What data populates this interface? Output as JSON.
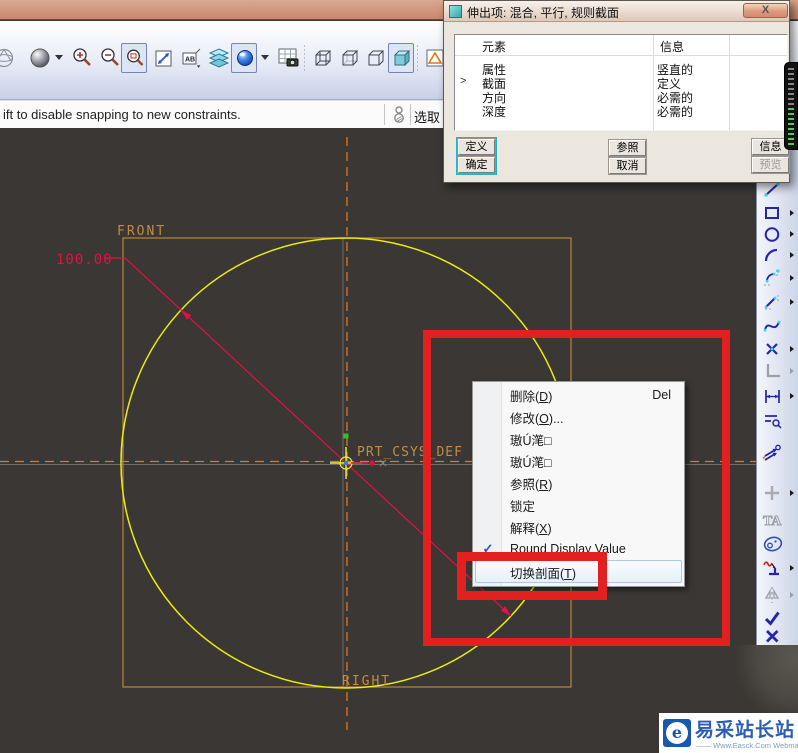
{
  "message_bar": {
    "text": "ift to disable snapping to new constraints.",
    "select_label": "选取"
  },
  "dialog": {
    "title": "伸出项: 混合, 平行, 规则截面",
    "close_glyph": "X",
    "table": {
      "columns": [
        "元素",
        "信息"
      ],
      "selected_marker": ">",
      "rows": [
        {
          "element": "属性",
          "info": "竖直的"
        },
        {
          "element": "截面",
          "info": "定义"
        },
        {
          "element": "方向",
          "info": "必需的"
        },
        {
          "element": "深度",
          "info": "必需的"
        }
      ]
    },
    "buttons": {
      "define": "定义",
      "refs": "参照",
      "info": "信息",
      "ok": "确定",
      "cancel": "取消",
      "preview": "预览"
    }
  },
  "context_menu": {
    "check_glyph": "✓",
    "items": [
      {
        "label": "删除(D)",
        "shortcut": "Del"
      },
      {
        "label": "修改(O)..."
      },
      {
        "label": "璈Ú滗□"
      },
      {
        "label": "璈Ú滗□"
      },
      {
        "label": "参照(R)"
      },
      {
        "label": "锁定"
      },
      {
        "label": "解释(X)"
      },
      {
        "label": "Round Display Value",
        "checked": true
      },
      {
        "label": "切换剖面(T)",
        "highlighted": true
      }
    ]
  },
  "sketch": {
    "front_label": "FRONT",
    "right_label": "RIGHT",
    "csys_label": "PRT_CSYS_DEF",
    "dimension_value": "100.00"
  },
  "watermark": {
    "title": "易采站长站",
    "tagline": "—— Www.Easck.Com Webmaster",
    "logo_glyph": "e"
  },
  "colors": {
    "annotation_red": "#e32020",
    "sketch_yellow": "#ebeb10",
    "centerline_orange": "#e07818",
    "datum_tan": "#c08c44",
    "dimension_red": "#e61042",
    "titlebar_salmon": "#cf9076"
  },
  "toolbar": {
    "icons": [
      "orientation-sphere",
      "shaded-sphere",
      "zoom-in",
      "zoom-out",
      "zoom-fit",
      "refit",
      "datum-tag",
      "layers",
      "shaded-display",
      "view-manager",
      "wireframe-display",
      "hidden-line-display",
      "no-hidden-display",
      "shaded-model-display",
      "datum-toggle"
    ]
  },
  "right_toolbar": {
    "icons": [
      "line-tool",
      "rectangle-tool",
      "circle-tool",
      "arc-tool",
      "fillet-tool",
      "chamfer-tool",
      "spline-tool",
      "point-tool",
      "coordinate-system-tool",
      "dimension-tool",
      "perimeter-dimension-tool",
      "modify-dimension-tool",
      "constraint-tool",
      "text-tool",
      "palette-tool",
      "trim-tool",
      "mirror-tool",
      "accept-button",
      "cancel-button"
    ]
  }
}
